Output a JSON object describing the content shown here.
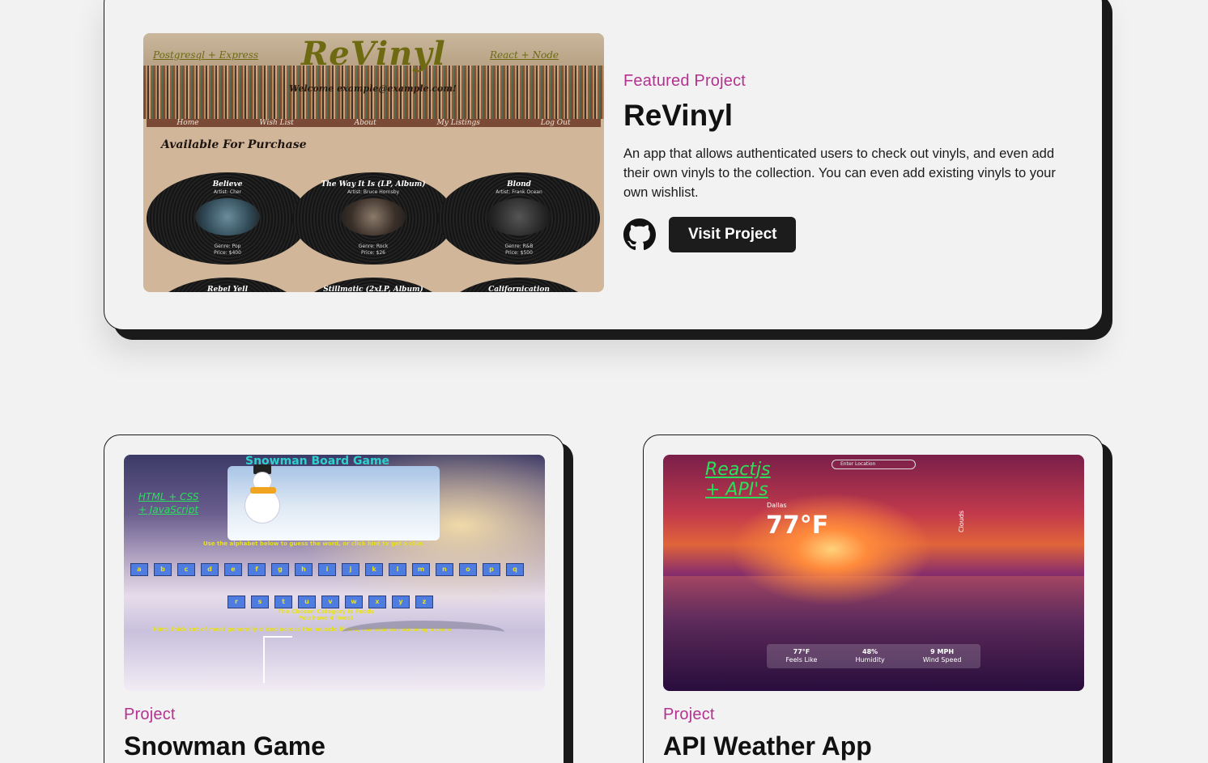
{
  "featured": {
    "eyebrow": "Featured Project",
    "title": "ReVinyl",
    "description": "An app that allows authenticated users to check out vinyls, and even add their own vinyls to the collection. You can even add existing vinyls to your own wishlist.",
    "visit_label": "Visit Project",
    "github_icon": "github-icon",
    "screenshot": {
      "left_tag": "Postgresql + Express",
      "logo": "ReVinyl",
      "right_tag": "React + Node",
      "welcome": "Welcome example@example.com!",
      "nav": [
        "Home",
        "Wish List",
        "About",
        "My Listings",
        "Log Out"
      ],
      "available": "Available For Purchase",
      "records": [
        {
          "title": "Believe",
          "artist": "Artist: Cher",
          "genre": "Genre: Pop",
          "price": "Price: $400"
        },
        {
          "title": "The Way It Is (LP, Album)",
          "artist": "Artist: Bruce Hornsby",
          "genre": "Genre: Rock",
          "price": "Price: $26"
        },
        {
          "title": "Blond",
          "artist": "Artist: Frank Ocean",
          "genre": "Genre: R&B",
          "price": "Price: $500"
        }
      ],
      "records_row2": [
        "Rebel Yell",
        "Stillmatic (2xLP, Album)",
        "Californication"
      ]
    }
  },
  "projects": [
    {
      "eyebrow": "Project",
      "title": "Snowman Game",
      "screenshot": {
        "title": "Snowman Board Game",
        "lang1": "HTML + CSS",
        "lang2": "+ JavaScript",
        "hint": "Use the alphabet below to guess the word, or click hint to get a clue.",
        "row1": [
          "a",
          "b",
          "c",
          "d",
          "e",
          "f",
          "g",
          "h",
          "i",
          "j",
          "k",
          "l",
          "m",
          "n",
          "o",
          "p",
          "q"
        ],
        "row2": [
          "r",
          "s",
          "t",
          "u",
          "v",
          "w",
          "x",
          "y",
          "z"
        ],
        "category": "The Chosen Category Is Foods",
        "lives": "You have 4 lives!",
        "clue": "Hint: thick cut of meat generally sliced across the muscle fibers, sometimes including a bone"
      }
    },
    {
      "eyebrow": "Project",
      "title": "API Weather App",
      "screenshot": {
        "lang1": "Reactjs",
        "lang2": "+ API's",
        "location_placeholder": "Enter Location",
        "city": "Dallas",
        "temp": "77°F",
        "condition": "Clouds",
        "stats": [
          {
            "value": "77°F",
            "label": "Feels Like"
          },
          {
            "value": "48%",
            "label": "Humidity"
          },
          {
            "value": "9 MPH",
            "label": "Wind Speed"
          }
        ]
      }
    }
  ],
  "colors": {
    "accent": "#b3328f",
    "dark": "#1c1c1c",
    "background": "#f2f2f2"
  }
}
